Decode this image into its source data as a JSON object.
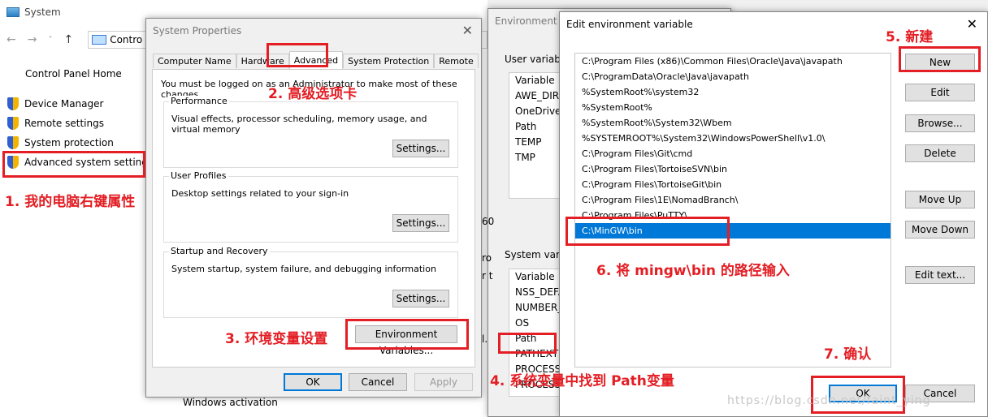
{
  "system": {
    "title": "System",
    "address": "Contro",
    "control_panel_home": "Control Panel Home",
    "sidebar": [
      {
        "label": "Device Manager"
      },
      {
        "label": "Remote settings"
      },
      {
        "label": "System protection"
      },
      {
        "label": "Advanced system settings"
      }
    ],
    "windows_activation": "Windows activation"
  },
  "sysprops": {
    "title": "System Properties",
    "tabs": [
      "Computer Name",
      "Hardware",
      "Advanced",
      "System Protection",
      "Remote"
    ],
    "note": "You must be logged on as an Administrator to make most of these changes.",
    "performance": {
      "label": "Performance",
      "text": "Visual effects, processor scheduling, memory usage, and virtual memory",
      "button": "Settings..."
    },
    "user_profiles": {
      "label": "User Profiles",
      "text": "Desktop settings related to your sign-in",
      "button": "Settings..."
    },
    "startup": {
      "label": "Startup and Recovery",
      "text": "System startup, system failure, and debugging information",
      "button": "Settings..."
    },
    "env_button": "Environment Variables...",
    "ok": "OK",
    "cancel": "Cancel",
    "apply": "Apply"
  },
  "envvars": {
    "title": "Environment V",
    "user_label": "User variable",
    "user_header": "Variable",
    "user_vars": [
      "AWE_DIR",
      "OneDrive",
      "Path",
      "TEMP",
      "TMP"
    ],
    "system_label": "System varia",
    "system_header": "Variable",
    "system_vars": [
      "NSS_DEFA",
      "NUMBER_",
      "OS",
      "Path",
      "PATHEXT",
      "PROCESSO",
      "PROCESSO"
    ],
    "frag_60": "60",
    "frag_ro": "ro",
    "frag_rt": "r t",
    "frag_l": "l."
  },
  "editenv": {
    "title": "Edit environment variable",
    "entries": [
      "C:\\Program Files (x86)\\Common Files\\Oracle\\Java\\javapath",
      "C:\\ProgramData\\Oracle\\Java\\javapath",
      "%SystemRoot%\\system32",
      "%SystemRoot%",
      "%SystemRoot%\\System32\\Wbem",
      "%SYSTEMROOT%\\System32\\WindowsPowerShell\\v1.0\\",
      "C:\\Program Files\\Git\\cmd",
      "C:\\Program Files\\TortoiseSVN\\bin",
      "C:\\Program Files\\TortoiseGit\\bin",
      "C:\\Program Files\\1E\\NomadBranch\\",
      "C:\\Program Files\\PuTTY\\",
      "C:\\MinGW\\bin"
    ],
    "buttons": {
      "new": "New",
      "edit": "Edit",
      "browse": "Browse...",
      "delete": "Delete",
      "move_up": "Move Up",
      "move_down": "Move Down",
      "edit_text": "Edit text...",
      "ok": "OK",
      "cancel": "Cancel"
    }
  },
  "annotations": {
    "step1": "1. 我的电脑右键属性",
    "step2": "2. 高级选项卡",
    "step3": "3. 环境变量设置",
    "step4": "4. 系统变量中找到 Path变量",
    "step5": "5. 新建",
    "step6": "6. 将 mingw\\bin 的路径输入",
    "step7": "7. 确认",
    "color": "#e31e24"
  },
  "watermark": "https://blog.csdn.net/faint_ying"
}
